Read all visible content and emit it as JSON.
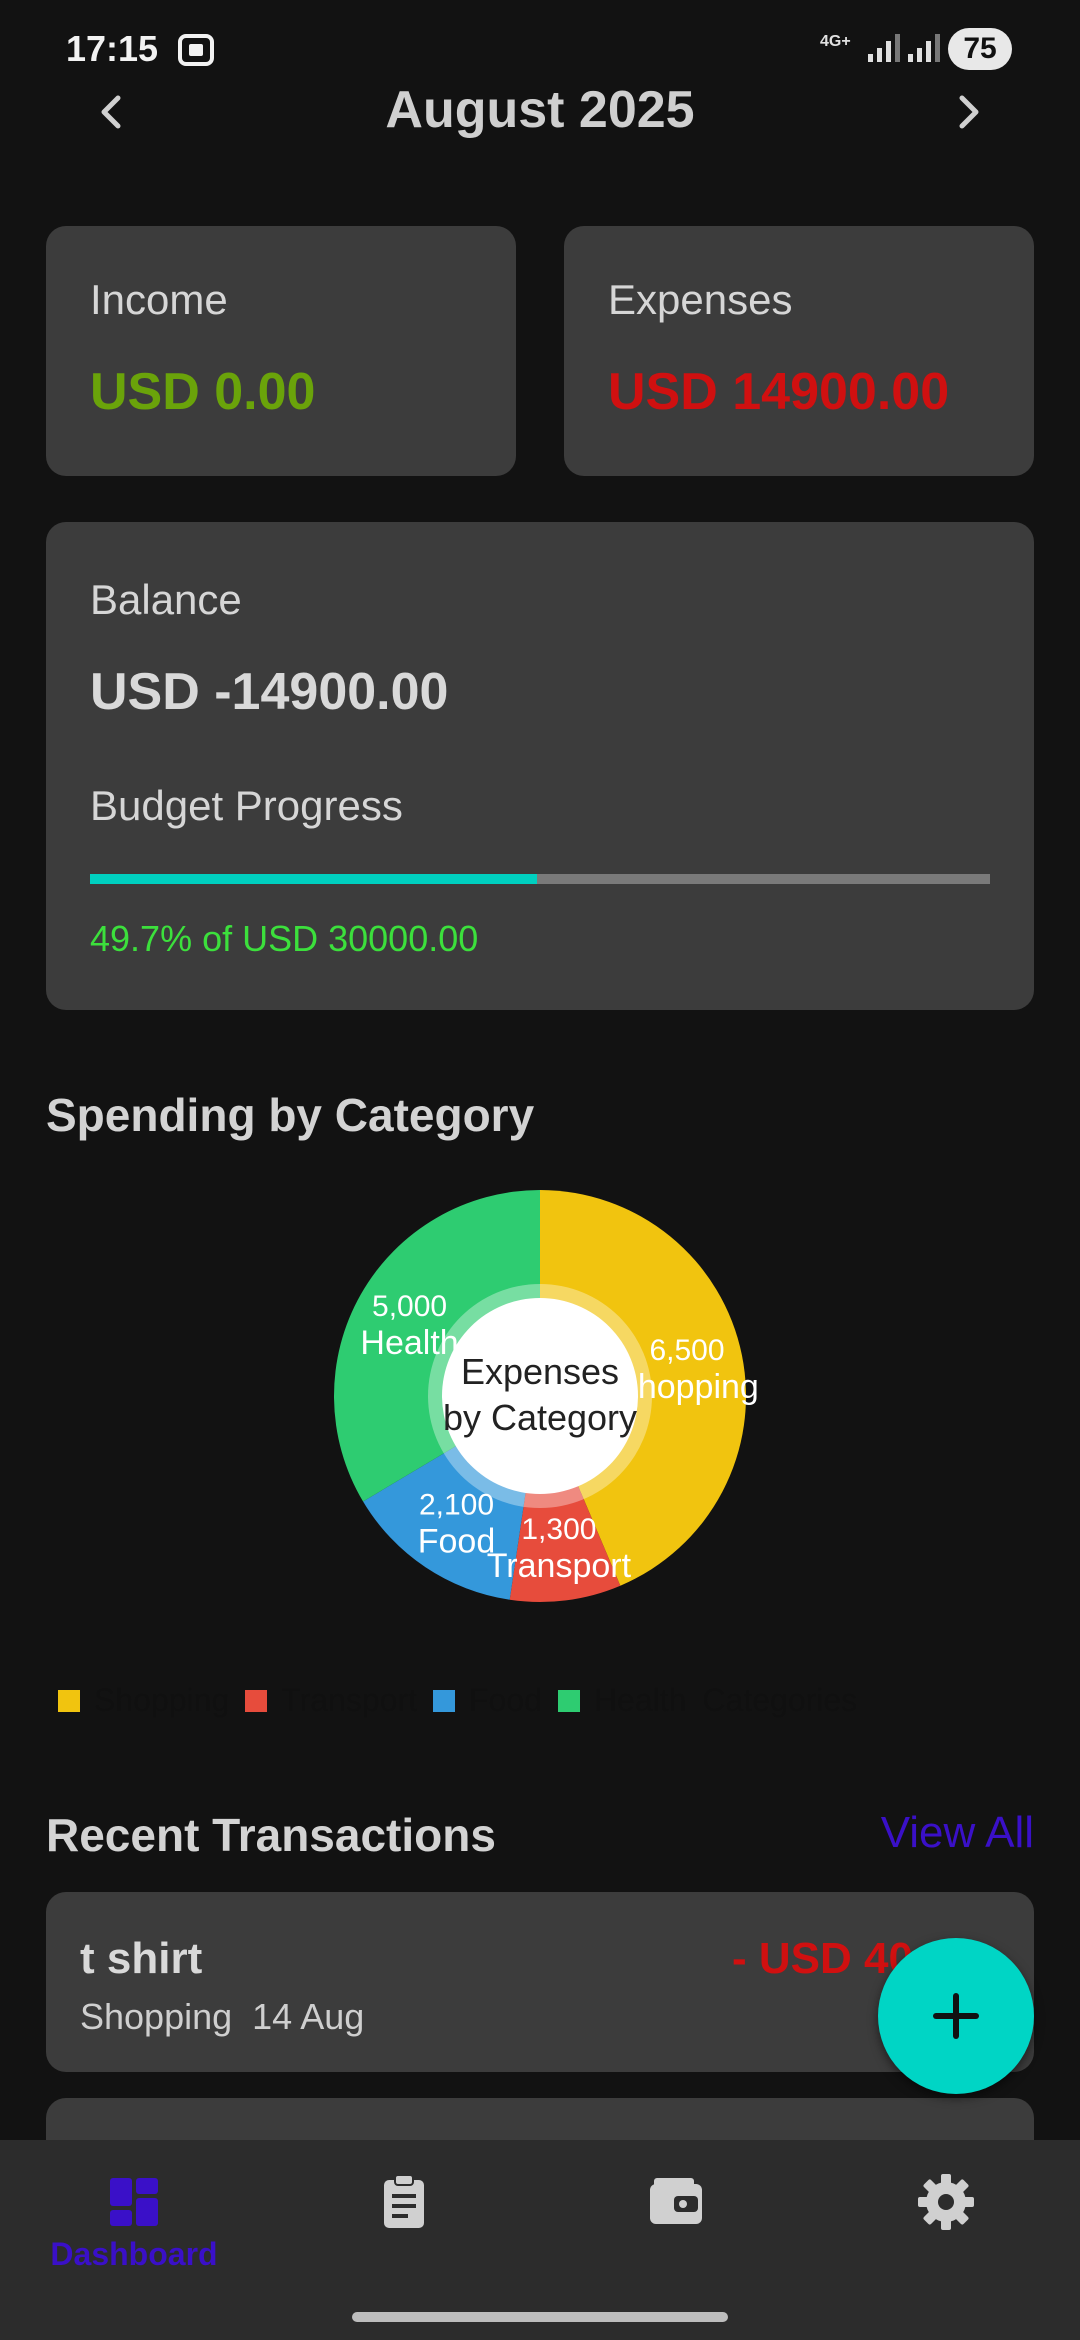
{
  "status_bar": {
    "time": "17:15",
    "network": "4G+",
    "battery": "75"
  },
  "header": {
    "title": "August 2025"
  },
  "income": {
    "label": "Income",
    "value": "USD 0.00",
    "color": "#6aa30a"
  },
  "expenses": {
    "label": "Expenses",
    "value": "USD 14900.00",
    "color": "#d01010"
  },
  "balance": {
    "label": "Balance",
    "value": "USD -14900.00",
    "budget_label": "Budget Progress",
    "progress_text": "49.7% of USD 30000.00",
    "progress_fraction": 0.497
  },
  "spending_section": {
    "title": "Spending by Category"
  },
  "chart_data": {
    "type": "pie",
    "title": "Expenses by Category",
    "categories": [
      "Shopping",
      "Transport",
      "Food",
      "Health"
    ],
    "values": [
      6500,
      1300,
      2100,
      5000
    ],
    "value_labels": [
      "6,500",
      "1,300",
      "2,100",
      "5,000"
    ],
    "colors": [
      "#f1c40f",
      "#e74c3c",
      "#3498db",
      "#2ecc71"
    ],
    "legend_title": "Categories"
  },
  "recent": {
    "title": "Recent Transactions",
    "view_all": "View All",
    "transactions": [
      {
        "title": "t shirt",
        "category": "Shopping",
        "date": "14 Aug",
        "amount": "- USD 40"
      }
    ]
  },
  "bottom_nav": {
    "items": [
      {
        "label": "Dashboard",
        "icon": "dashboard-icon",
        "active": true
      },
      {
        "label": "",
        "icon": "clipboard-icon"
      },
      {
        "label": "",
        "icon": "wallet-icon"
      },
      {
        "label": "",
        "icon": "gear-icon"
      }
    ]
  }
}
